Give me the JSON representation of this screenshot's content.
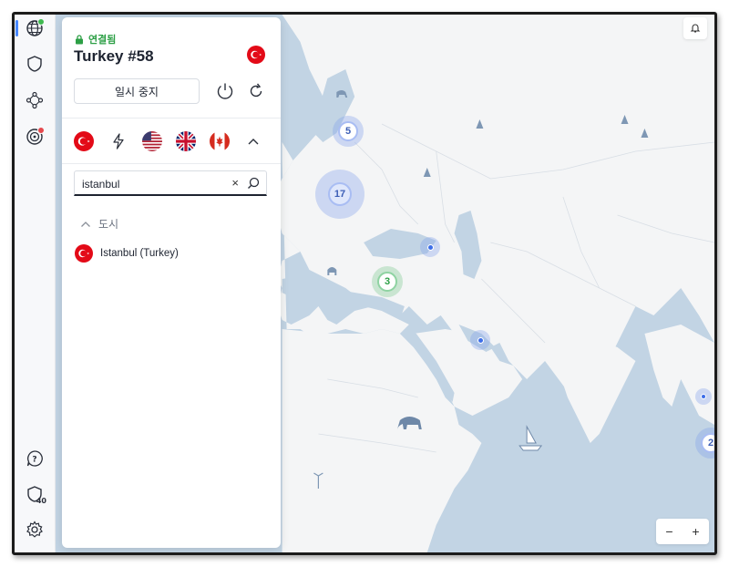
{
  "connection": {
    "status": "연결됨",
    "server_name": "Turkey #58",
    "pause_label": "일시 중지"
  },
  "quick_connect": [
    "turkey-flag",
    "lightning-icon",
    "usa-flag",
    "uk-flag",
    "canada-flag",
    "chevron-up-icon"
  ],
  "search": {
    "value": "istanbul",
    "clear_label": "×"
  },
  "results": {
    "section_label": "도시",
    "items": [
      {
        "label": "Istanbul (Turkey)"
      }
    ]
  },
  "sidebar": {
    "badge_count": "40"
  },
  "map": {
    "clusters": [
      {
        "label": "5"
      },
      {
        "label": "17"
      },
      {
        "label": "3"
      },
      {
        "label": "2"
      }
    ],
    "zoom_out": "−",
    "zoom_in": "+"
  },
  "colors": {
    "accent": "#4687ff",
    "connected": "#3fb950",
    "sea": "#c2d4e4",
    "land": "#f4f5f6"
  }
}
